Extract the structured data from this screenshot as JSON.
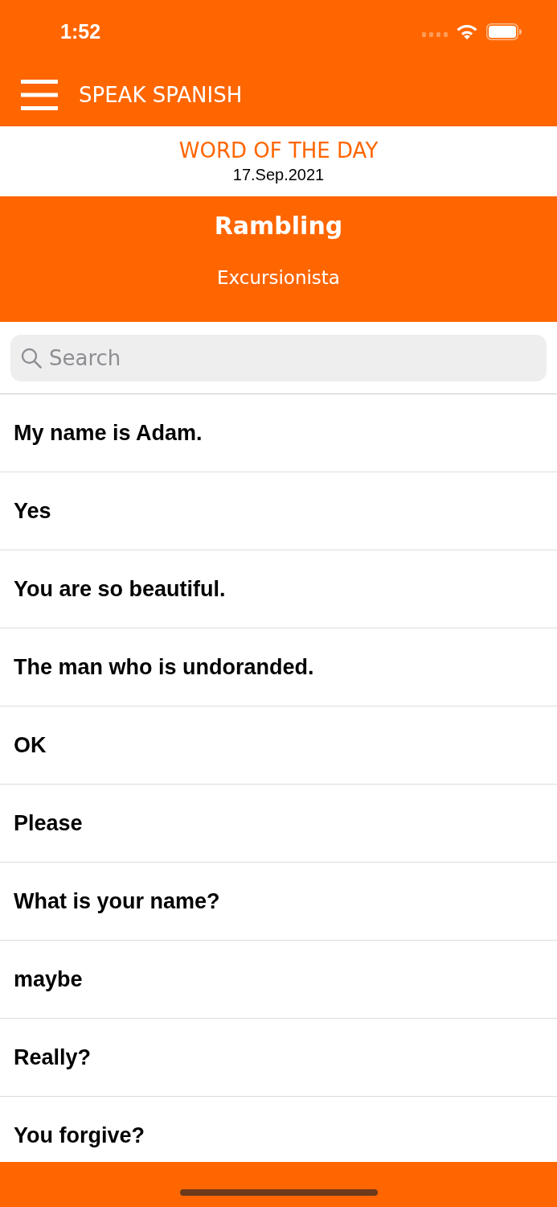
{
  "status_bar": {
    "time": "1:52"
  },
  "nav_bar": {
    "title": "SPEAK SPANISH"
  },
  "word_of_the_day": {
    "heading": "WORD OF THE DAY",
    "date": "17.Sep.2021",
    "word": "Rambling",
    "translation": "Excursionista"
  },
  "search": {
    "placeholder": "Search"
  },
  "phrases": [
    {
      "text": "My name is Adam."
    },
    {
      "text": "Yes"
    },
    {
      "text": "You are so beautiful."
    },
    {
      "text": "The man who is undoranded."
    },
    {
      "text": "OK"
    },
    {
      "text": "Please"
    },
    {
      "text": "What is your name?"
    },
    {
      "text": "maybe"
    },
    {
      "text": "Really?"
    },
    {
      "text": "You forgive?"
    }
  ]
}
